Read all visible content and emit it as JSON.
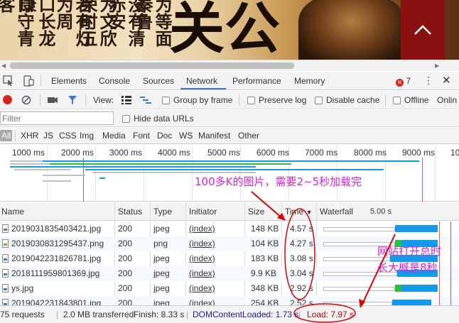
{
  "banner": {
    "calligraphy": [
      "口守青客",
      "口长龙康",
      "若有灯为周",
      "为文欣荣时五",
      "没有清赤安",
      "为等面秦鲁"
    ],
    "big_char": "关公",
    "up_icon": "chevron-up-icon",
    "accent": "#8b1010"
  },
  "devtools": {
    "tabs": [
      "Elements",
      "Console",
      "Sources",
      "Network",
      "Performance",
      "Memory"
    ],
    "active_tab": "Network",
    "error_count": "7",
    "toolbar": {
      "view_label": "View:",
      "group_by_frame": "Group by frame",
      "preserve_log": "Preserve log",
      "disable_cache": "Disable cache",
      "offline": "Offline",
      "online": "Onlin"
    },
    "filter": {
      "placeholder": "Filter",
      "hide_data_urls": "Hide data URLs"
    },
    "type_filters": [
      "All",
      "XHR",
      "JS",
      "CSS",
      "Img",
      "Media",
      "Font",
      "Doc",
      "WS",
      "Manifest",
      "Other"
    ],
    "overview_ticks": [
      "1000 ms",
      "2000 ms",
      "3000 ms",
      "4000 ms",
      "5000 ms",
      "6000 ms",
      "7000 ms",
      "8000 ms",
      "9000 ms",
      "10"
    ],
    "columns": {
      "name": "Name",
      "status": "Status",
      "type": "Type",
      "initiator": "Initiator",
      "size": "Size",
      "time": "Time",
      "sort_icon": "▼",
      "waterfall": "Waterfall",
      "waterfall_scale": "5.00 s"
    },
    "rows": [
      {
        "name": "2019031835403421.jpg",
        "status": "200",
        "type": "jpeg",
        "initiator": "(index)",
        "size": "148 KB",
        "time": "4.57 s",
        "icon": "image-file-icon",
        "wf_start": 3.5,
        "wf_wait": 0.0,
        "wf_dur": 4.57
      },
      {
        "name": "2019030831295437.png",
        "status": "200",
        "type": "png",
        "initiator": "(index)",
        "size": "104 KB",
        "time": "4.27 s",
        "icon": "png-file-icon",
        "wf_start": 3.5,
        "wf_wait": 0.3,
        "wf_dur": 4.27
      },
      {
        "name": "2019042231826781.jpg",
        "status": "200",
        "type": "jpeg",
        "initiator": "(index)",
        "size": "183 KB",
        "time": "3.08 s",
        "icon": "image-file-icon",
        "wf_start": 3.3,
        "wf_wait": 0.0,
        "wf_dur": 3.08
      },
      {
        "name": "2018111959801369.jpg",
        "status": "200",
        "type": "jpeg",
        "initiator": "(index)",
        "size": "9.9 KB",
        "time": "3.04 s",
        "icon": "image-file-icon",
        "wf_start": 3.6,
        "wf_wait": 0.0,
        "wf_dur": 3.04
      },
      {
        "name": "ys.jpg",
        "status": "200",
        "type": "jpeg",
        "initiator": "(index)",
        "size": "348 KB",
        "time": "2.92 s",
        "icon": "image-file-icon",
        "wf_start": 3.5,
        "wf_wait": 0.3,
        "wf_dur": 2.92
      },
      {
        "name": "2019042231843801.jpg",
        "status": "200",
        "type": "jpeg",
        "initiator": "(index)",
        "size": "254 KB",
        "time": "2.52 s",
        "icon": "image-file-icon",
        "wf_start": 3.4,
        "wf_wait": 0.0,
        "wf_dur": 2.52
      }
    ],
    "status_bar": {
      "requests": "75 requests",
      "transferred": "2.0 MB transferred",
      "finish": "Finish: 8.33 s",
      "dom_content_loaded": "DOMContentLoaded: 1.73 s",
      "load": "Load: 7.97 s"
    },
    "colors": {
      "accent_blue": "#3879d9",
      "dcl_blue": "#1a1aa6",
      "load_red": "#c80000",
      "waiting_green": "#2bbf3f",
      "download_blue": "#139ae8"
    }
  },
  "annotations": {
    "image_note": "100多K的图片，需要2~5秒加载完",
    "site_note_line1": "网站打开总时",
    "site_note_line2": "长大概是8秒",
    "color": "#e020e0"
  }
}
